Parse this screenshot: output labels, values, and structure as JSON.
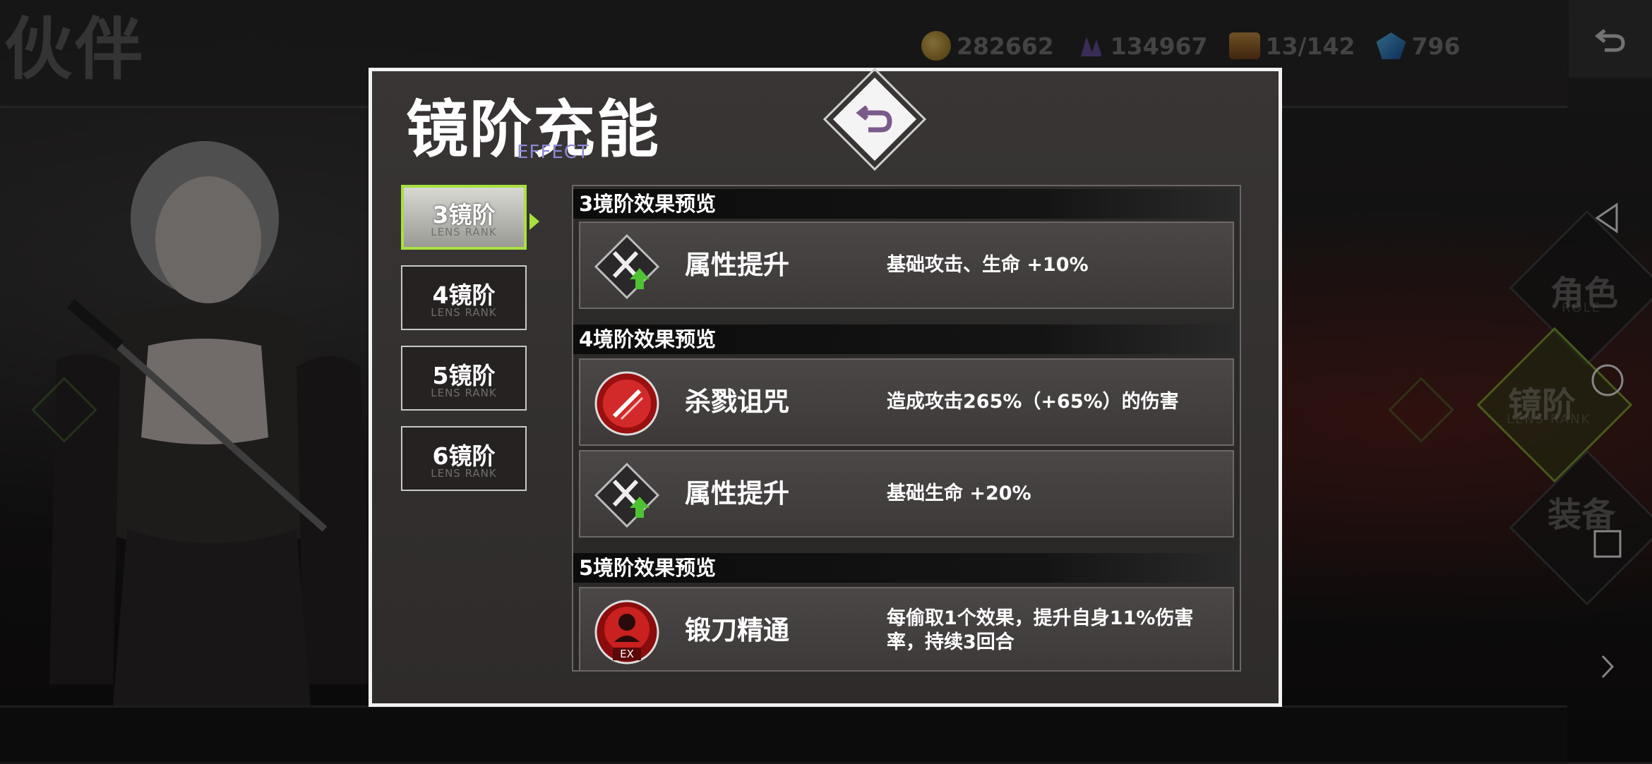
{
  "background": {
    "page_title": "伙伴",
    "resources": [
      {
        "icon": "gold-coin-icon",
        "value": "282662"
      },
      {
        "icon": "crystal-icon",
        "value": "134967"
      },
      {
        "icon": "chest-icon",
        "value": "13/142"
      },
      {
        "icon": "gem-icon",
        "value": "796"
      }
    ],
    "side_nav": [
      {
        "label": "角色",
        "sub": "ROLE"
      },
      {
        "label": "镜阶",
        "sub": "LENS RANK"
      },
      {
        "label": "装备",
        "sub": ""
      }
    ]
  },
  "dialog": {
    "title": "镜阶充能",
    "subtitle": "EFFECT",
    "tabs": [
      {
        "label": "3镜阶",
        "sub": "LENS RANK",
        "active": true
      },
      {
        "label": "4镜阶",
        "sub": "LENS RANK",
        "active": false
      },
      {
        "label": "5镜阶",
        "sub": "LENS RANK",
        "active": false
      },
      {
        "label": "6镜阶",
        "sub": "LENS RANK",
        "active": false
      }
    ],
    "sections": [
      {
        "header": "3境阶效果预览",
        "effects": [
          {
            "icon": "sword-upgrade-icon",
            "name": "属性提升",
            "desc": "基础攻击、生命 +10%"
          }
        ]
      },
      {
        "header": "4境阶效果预览",
        "effects": [
          {
            "icon": "slash-curse-icon",
            "name": "杀戮诅咒",
            "desc": "造成攻击265%（+65%）的伤害"
          },
          {
            "icon": "sword-upgrade-icon",
            "name": "属性提升",
            "desc": "基础生命 +20%"
          }
        ]
      },
      {
        "header": "5境阶效果预览",
        "effects": [
          {
            "icon": "ex-skill-icon",
            "name": "锻刀精通",
            "desc": "每偷取1个效果，提升自身11%伤害率，持续3回合",
            "badge": "EX"
          }
        ]
      }
    ]
  },
  "colors": {
    "accent_green": "#a8e040",
    "dialog_border": "#f2f2f2",
    "subtitle_purple": "#8c88d8",
    "close_icon_purple": "#7a5a8a"
  }
}
